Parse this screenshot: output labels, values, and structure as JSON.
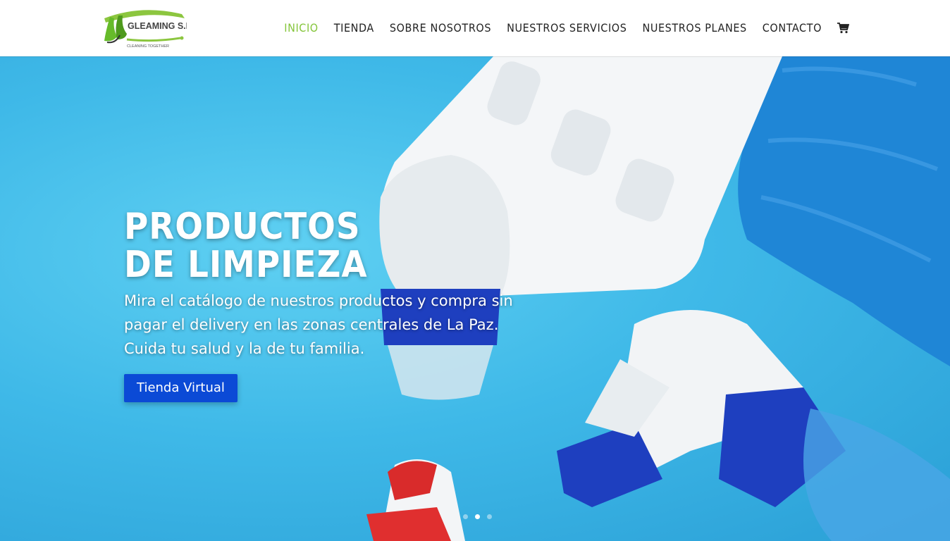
{
  "brand": {
    "name": "GLEAMING S.R.L.",
    "tagline": "CLEANING TOGETHER",
    "accent_color": "#84c53a"
  },
  "nav": {
    "items": [
      {
        "label": "INICIO",
        "active": true
      },
      {
        "label": "TIENDA",
        "active": false
      },
      {
        "label": "SOBRE NOSOTROS",
        "active": false
      },
      {
        "label": "NUESTROS SERVICIOS",
        "active": false
      },
      {
        "label": "NUESTROS PLANES",
        "active": false
      },
      {
        "label": "CONTACTO",
        "active": false
      }
    ],
    "cart_icon": "shopping-cart-icon"
  },
  "hero": {
    "title": "PRODUCTOS DE LIMPIEZA",
    "text": "Mira el catálogo de nuestros productos y compra sin pagar el delivery en las zonas centrales de La Paz. Cuida tu salud y la de tu familia.",
    "button_label": "Tienda Virtual",
    "button_color": "#0b4ad6",
    "background_color": "#3fb9e8",
    "slides_total": 3,
    "active_slide": 2
  }
}
